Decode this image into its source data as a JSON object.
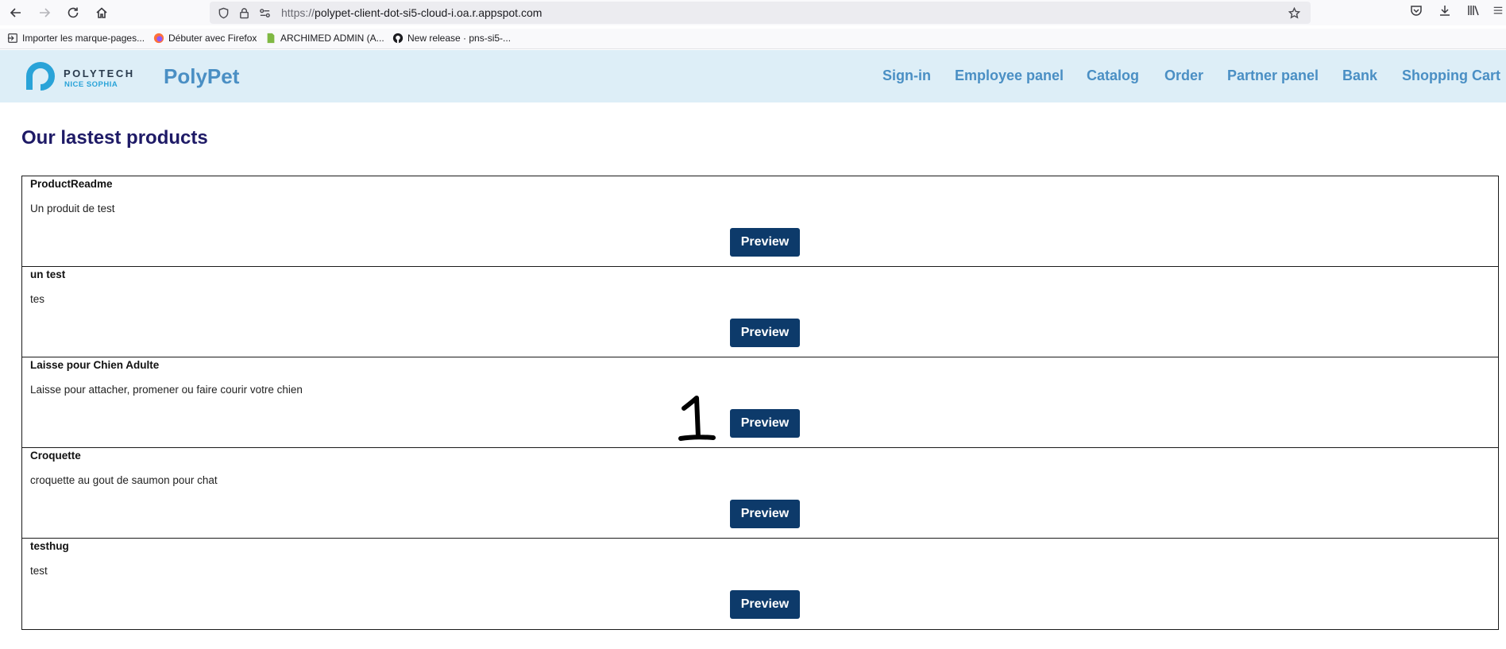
{
  "browser": {
    "url_proto": "https://",
    "url_rest": "polypet-client-dot-si5-cloud-i.oa.r.appspot.com",
    "bookmarks": [
      {
        "label": "Importer les marque-pages..."
      },
      {
        "label": "Débuter avec Firefox"
      },
      {
        "label": "ARCHIMED ADMIN (A..."
      },
      {
        "label": "New release · pns-si5-..."
      }
    ]
  },
  "header": {
    "logo_word": "POLYTECH",
    "logo_sub": "NICE SOPHIA",
    "brand": "PolyPet",
    "nav": [
      {
        "label": "Sign-in"
      },
      {
        "label": "Employee panel"
      },
      {
        "label": "Catalog"
      },
      {
        "label": "Order"
      },
      {
        "label": "Partner panel"
      },
      {
        "label": "Bank"
      },
      {
        "label": "Shopping Cart"
      }
    ]
  },
  "main": {
    "title": "Our lastest products",
    "products": [
      {
        "name": "ProductReadme",
        "description": "Un produit de test",
        "button": "Preview"
      },
      {
        "name": "un test",
        "description": "tes",
        "button": "Preview"
      },
      {
        "name": "Laisse pour Chien Adulte",
        "description": "Laisse pour attacher, promener ou faire courir votre chien",
        "button": "Preview"
      },
      {
        "name": "Croquette",
        "description": "croquette au gout de saumon pour chat",
        "button": "Preview"
      },
      {
        "name": "testhug",
        "description": "test",
        "button": "Preview"
      }
    ]
  },
  "colors": {
    "header_bg": "#ddeef7",
    "nav_link": "#4a8fc4",
    "title": "#1e1a66",
    "button_bg": "#0d3a6a"
  }
}
